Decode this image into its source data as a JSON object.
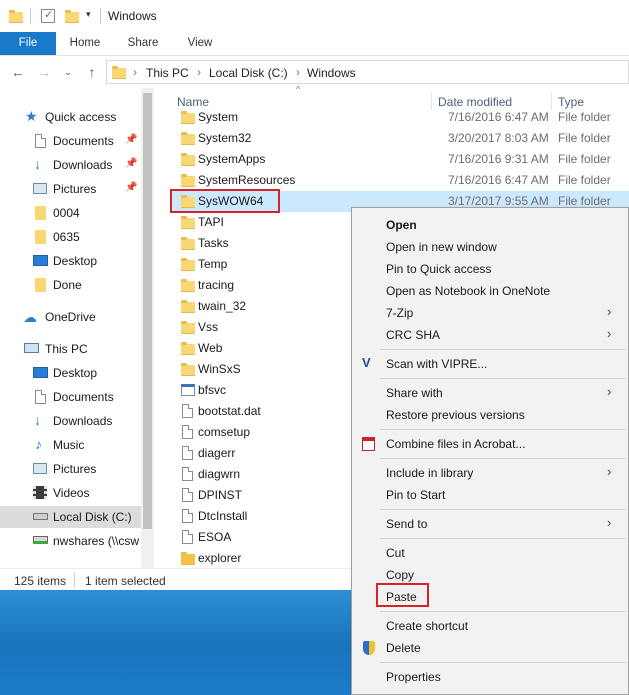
{
  "window": {
    "title": "Windows"
  },
  "ribbon": {
    "tabs": [
      "File",
      "Home",
      "Share",
      "View"
    ]
  },
  "address": {
    "crumbs": [
      "This PC",
      "Local Disk (C:)",
      "Windows"
    ]
  },
  "sidebar": {
    "items": [
      {
        "label": "Quick access",
        "icon": "star-icon"
      },
      {
        "label": "Documents",
        "icon": "documents-icon",
        "pinned": true
      },
      {
        "label": "Downloads",
        "icon": "download-icon",
        "pinned": true
      },
      {
        "label": "Pictures",
        "icon": "pictures-icon",
        "pinned": true
      },
      {
        "label": "0004",
        "icon": "folder-icon"
      },
      {
        "label": "0635",
        "icon": "folder-icon"
      },
      {
        "label": "Desktop",
        "icon": "desktop-icon"
      },
      {
        "label": "Done",
        "icon": "folder-icon"
      },
      {
        "label": "OneDrive",
        "icon": "onedrive-icon"
      },
      {
        "label": "This PC",
        "icon": "computer-icon"
      },
      {
        "label": "Desktop",
        "icon": "desktop-icon"
      },
      {
        "label": "Documents",
        "icon": "documents-icon"
      },
      {
        "label": "Downloads",
        "icon": "download-icon"
      },
      {
        "label": "Music",
        "icon": "music-icon"
      },
      {
        "label": "Pictures",
        "icon": "pictures-icon"
      },
      {
        "label": "Videos",
        "icon": "videos-icon"
      },
      {
        "label": "Local Disk (C:)",
        "icon": "drive-icon"
      },
      {
        "label": "nwshares (\\\\csw",
        "icon": "network-drive-icon"
      }
    ]
  },
  "columns": {
    "name": "Name",
    "date": "Date modified",
    "type": "Type"
  },
  "files": [
    {
      "name": "System",
      "date": "7/16/2016 6:47 AM",
      "type": "File folder"
    },
    {
      "name": "System32",
      "date": "3/20/2017 8:03 AM",
      "type": "File folder"
    },
    {
      "name": "SystemApps",
      "date": "7/16/2016 9:31 AM",
      "type": "File folder"
    },
    {
      "name": "SystemResources",
      "date": "7/16/2016 6:47 AM",
      "type": "File folder"
    },
    {
      "name": "SysWOW64",
      "date": "3/17/2017 9:55 AM",
      "type": "File folder"
    },
    {
      "name": "TAPI",
      "date": "",
      "type": ""
    },
    {
      "name": "Tasks",
      "date": "",
      "type": ""
    },
    {
      "name": "Temp",
      "date": "",
      "type": ""
    },
    {
      "name": "tracing",
      "date": "",
      "type": ""
    },
    {
      "name": "twain_32",
      "date": "",
      "type": ""
    },
    {
      "name": "Vss",
      "date": "",
      "type": ""
    },
    {
      "name": "Web",
      "date": "",
      "type": ""
    },
    {
      "name": "WinSxS",
      "date": "",
      "type": ""
    },
    {
      "name": "bfsvc",
      "date": "",
      "type": ""
    },
    {
      "name": "bootstat.dat",
      "date": "",
      "type": ""
    },
    {
      "name": "comsetup",
      "date": "",
      "type": ""
    },
    {
      "name": "diagerr",
      "date": "",
      "type": ""
    },
    {
      "name": "diagwrn",
      "date": "",
      "type": ""
    },
    {
      "name": "DPINST",
      "date": "",
      "type": ""
    },
    {
      "name": "DtcInstall",
      "date": "",
      "type": ""
    },
    {
      "name": "ESOA",
      "date": "",
      "type": ""
    },
    {
      "name": "explorer",
      "date": "",
      "type": ""
    }
  ],
  "status": {
    "count": "125 items",
    "selected": "1 item selected"
  },
  "context_menu": {
    "items": [
      {
        "label": "Open",
        "bold": true
      },
      {
        "label": "Open in new window"
      },
      {
        "label": "Pin to Quick access"
      },
      {
        "label": "Open as Notebook in OneNote"
      },
      {
        "label": "7-Zip",
        "submenu": true
      },
      {
        "label": "CRC SHA",
        "submenu": true
      },
      {
        "label": "Scan with VIPRE...",
        "icon": "vipre-icon"
      },
      {
        "label": "Share with",
        "submenu": true
      },
      {
        "label": "Restore previous versions"
      },
      {
        "label": "Combine files in Acrobat...",
        "icon": "acrobat-icon"
      },
      {
        "label": "Include in library",
        "submenu": true
      },
      {
        "label": "Pin to Start"
      },
      {
        "label": "Send to",
        "submenu": true
      },
      {
        "label": "Cut"
      },
      {
        "label": "Copy"
      },
      {
        "label": "Paste"
      },
      {
        "label": "Create shortcut"
      },
      {
        "label": "Delete",
        "icon": "shield-icon"
      },
      {
        "label": "Properties"
      }
    ]
  },
  "colors": {
    "accent": "#1979ca",
    "selection": "#cce8ff",
    "highlight_box": "#d4232b"
  }
}
